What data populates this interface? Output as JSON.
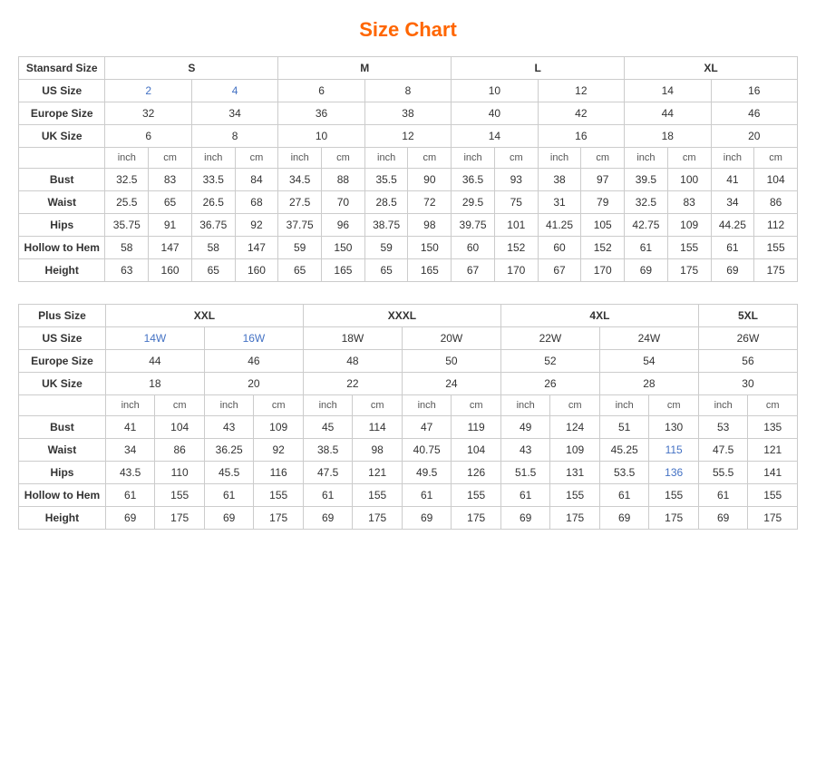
{
  "title": "Size Chart",
  "standard": {
    "headers": {
      "stansardSize": "Stansard Size",
      "s": "S",
      "m": "M",
      "l": "L",
      "xl": "XL"
    },
    "usSize": {
      "label": "US Size",
      "values": [
        "2",
        "4",
        "6",
        "8",
        "10",
        "12",
        "14",
        "16"
      ]
    },
    "europeSize": {
      "label": "Europe Size",
      "values": [
        "32",
        "34",
        "36",
        "38",
        "40",
        "42",
        "44",
        "46"
      ]
    },
    "ukSize": {
      "label": "UK Size",
      "values": [
        "6",
        "8",
        "10",
        "12",
        "14",
        "16",
        "18",
        "20"
      ]
    },
    "inchCm": [
      "inch",
      "cm",
      "inch",
      "cm",
      "inch",
      "cm",
      "inch",
      "cm",
      "inch",
      "cm",
      "inch",
      "cm",
      "inch",
      "cm",
      "inch",
      "cm"
    ],
    "bust": {
      "label": "Bust",
      "values": [
        "32.5",
        "83",
        "33.5",
        "84",
        "34.5",
        "88",
        "35.5",
        "90",
        "36.5",
        "93",
        "38",
        "97",
        "39.5",
        "100",
        "41",
        "104"
      ]
    },
    "waist": {
      "label": "Waist",
      "values": [
        "25.5",
        "65",
        "26.5",
        "68",
        "27.5",
        "70",
        "28.5",
        "72",
        "29.5",
        "75",
        "31",
        "79",
        "32.5",
        "83",
        "34",
        "86"
      ]
    },
    "hips": {
      "label": "Hips",
      "values": [
        "35.75",
        "91",
        "36.75",
        "92",
        "37.75",
        "96",
        "38.75",
        "98",
        "39.75",
        "101",
        "41.25",
        "105",
        "42.75",
        "109",
        "44.25",
        "112"
      ]
    },
    "hollowToHem": {
      "label": "Hollow to Hem",
      "values": [
        "58",
        "147",
        "58",
        "147",
        "59",
        "150",
        "59",
        "150",
        "60",
        "152",
        "60",
        "152",
        "61",
        "155",
        "61",
        "155"
      ]
    },
    "height": {
      "label": "Height",
      "values": [
        "63",
        "160",
        "65",
        "160",
        "65",
        "165",
        "65",
        "165",
        "67",
        "170",
        "67",
        "170",
        "69",
        "175",
        "69",
        "175"
      ]
    }
  },
  "plus": {
    "headers": {
      "plusSize": "Plus Size",
      "xxl": "XXL",
      "xxxl": "XXXL",
      "fourXL": "4XL",
      "fiveXL": "5XL"
    },
    "usSize": {
      "label": "US Size",
      "values": [
        "14W",
        "16W",
        "18W",
        "20W",
        "22W",
        "24W",
        "26W"
      ]
    },
    "europeSize": {
      "label": "Europe Size",
      "values": [
        "44",
        "46",
        "48",
        "50",
        "52",
        "54",
        "56"
      ]
    },
    "ukSize": {
      "label": "UK Size",
      "values": [
        "18",
        "20",
        "22",
        "24",
        "26",
        "28",
        "30"
      ]
    },
    "inchCm": [
      "inch",
      "cm",
      "inch",
      "cm",
      "inch",
      "cm",
      "inch",
      "cm",
      "inch",
      "cm",
      "inch",
      "cm",
      "inch",
      "cm"
    ],
    "bust": {
      "label": "Bust",
      "values": [
        "41",
        "104",
        "43",
        "109",
        "45",
        "114",
        "47",
        "119",
        "49",
        "124",
        "51",
        "130",
        "53",
        "135"
      ]
    },
    "waist": {
      "label": "Waist",
      "values": [
        "34",
        "86",
        "36.25",
        "92",
        "38.5",
        "98",
        "40.75",
        "104",
        "43",
        "109",
        "45.25",
        "115",
        "47.5",
        "121"
      ]
    },
    "hips": {
      "label": "Hips",
      "values": [
        "43.5",
        "110",
        "45.5",
        "116",
        "47.5",
        "121",
        "49.5",
        "126",
        "51.5",
        "131",
        "53.5",
        "136",
        "55.5",
        "141"
      ]
    },
    "hollowToHem": {
      "label": "Hollow to Hem",
      "values": [
        "61",
        "155",
        "61",
        "155",
        "61",
        "155",
        "61",
        "155",
        "61",
        "155",
        "61",
        "155",
        "61",
        "155"
      ]
    },
    "height": {
      "label": "Height",
      "values": [
        "69",
        "175",
        "69",
        "175",
        "69",
        "175",
        "69",
        "175",
        "69",
        "175",
        "69",
        "175",
        "69",
        "175"
      ]
    }
  }
}
